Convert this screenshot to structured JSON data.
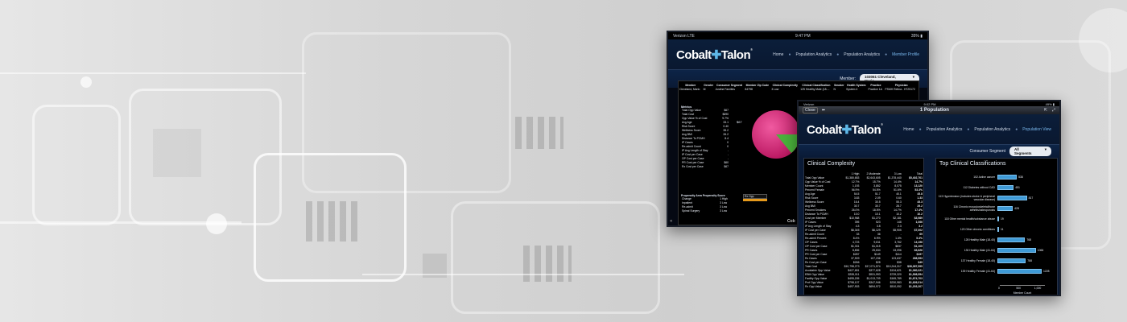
{
  "back_tablet": {
    "status": {
      "carrier": "Verizon  LTE",
      "time": "9:47 PM",
      "battery": "35% ▮"
    },
    "logo": {
      "text_a": "Cobalt",
      "text_b": "Talon",
      "mark": "®"
    },
    "breadcrumbs": [
      "Home",
      "Population Analytics",
      "Population Analytics",
      "Member Profile"
    ],
    "member_label": "Member:",
    "member_value": "103061 Cleveland, Mario",
    "columns": [
      "Member",
      "Gender",
      "Consumer Segment",
      "Member Zip Code",
      "Clinical Complexity",
      "Clinical Classification",
      "Smoker",
      "Health System",
      "Practice",
      "Physician"
    ],
    "row": [
      "Cleveland, Mario",
      "M",
      "Justine Families",
      "84798",
      "3 Low",
      "125 Healthy Male (18-...",
      "N",
      "System 4",
      "Practice 1A",
      "PSMH Retina - H725172"
    ],
    "metrics_title": "Metrics",
    "metrics": [
      [
        "Total Opp Value",
        "$67"
      ],
      [
        "Total Cost",
        "$690"
      ],
      [
        "Opp Value % of Cost",
        "9.7%"
      ],
      [
        "Avg Age",
        "33.1"
      ],
      [
        "Risk Score",
        "0.40"
      ],
      [
        "Wellness Score",
        "35.2"
      ],
      [
        "Avg BMI",
        "26.2"
      ],
      [
        "Distance To PCMH",
        "8.4"
      ],
      [
        "IP Cases",
        "0"
      ],
      [
        "Re-admit Count",
        "0"
      ],
      [
        "IP Avg Length of Stay",
        "-"
      ],
      [
        "IP Cost per Case",
        "-"
      ],
      [
        "OP Cost per Case",
        "-"
      ],
      [
        "PR Cost per Case",
        "$60"
      ],
      [
        "Rx Cost per Case",
        "$67"
      ]
    ],
    "pie_label": "$67",
    "pie_legend": "Rx Opp",
    "propensity_header": "Propensity Area  Propensity Score",
    "propensity": [
      [
        "Change",
        "1 High"
      ],
      [
        "Inpatient",
        "3 Low"
      ],
      [
        "Re-admit",
        "3 Low"
      ],
      [
        "Spinal Surgery",
        "3 Low"
      ]
    ],
    "footer_logo": "Cob"
  },
  "front_tablet": {
    "status": {
      "carrier": "Verizon",
      "time": "9:02 PM",
      "battery": "49% ▮"
    },
    "toolbar": {
      "close": "Close",
      "title": "1 Population"
    },
    "logo": {
      "text_a": "Cobalt",
      "text_b": "Talon",
      "mark": "®"
    },
    "breadcrumbs": [
      "Home",
      "Population Analytics",
      "Population Analytics",
      "Population View"
    ],
    "segment_label": "Consumer Segment",
    "segment_value": "All Segments",
    "complexity": {
      "title": "Clinical Complexity",
      "headers": [
        "",
        "1 High",
        "2 Moderate",
        "3 Low",
        "Total"
      ],
      "rows": [
        [
          "Total Opp Value",
          "$1,380,653",
          "$2,643,605",
          "$1,378,440",
          "$5,402,701"
        ],
        [
          "Opp Value % of Cost",
          "12.7%",
          "15.7%",
          "14.4%",
          "14.7%"
        ],
        [
          "Member Count",
          "1,193",
          "3,852",
          "8,075",
          "13,120"
        ],
        [
          "Percent Female",
          "56.9%",
          "54.5%",
          "51.6%",
          "53.3%"
        ],
        [
          "Avg Age",
          "54.5",
          "51.7",
          "40.1",
          "45.8"
        ],
        [
          "Risk Score",
          "3.83",
          "2.09",
          "0.60",
          "1.33"
        ],
        [
          "Wellness Score",
          "16.4",
          "30.5",
          "55.3",
          "45.3"
        ],
        [
          "Avg BMI",
          "30.7",
          "30.7",
          "28.7",
          "29.2"
        ],
        [
          "Percent Smokers",
          "26.0%",
          "18.5%",
          "14.7%",
          "17.4%"
        ],
        [
          "Distance To PCMH",
          "10.0",
          "10.1",
          "10.2",
          "10.2"
        ],
        [
          "Cost per Member",
          "$10,968",
          "$1,270",
          "$2,181",
          "$3,989"
        ],
        [
          "IP Cases",
          "395",
          "523",
          "148",
          "1,066"
        ],
        [
          "IP Avg Length of Stay",
          "4.3",
          "3.8",
          "2.3",
          "3.2"
        ],
        [
          "IP Cost per Case",
          "$6,345",
          "$6,129",
          "$5,905",
          "$7,002"
        ],
        [
          "Re-admit Count",
          "33",
          "36",
          "-",
          "69"
        ],
        [
          "Re-admit Percent",
          "8.4%",
          "6.9%",
          "1.4%",
          "5.3%"
        ],
        [
          "OP Cases",
          "4,723",
          "9,811",
          "3,762",
          "14,196"
        ],
        [
          "OP Cost per Case",
          "$1,331",
          "$1,015",
          "$837",
          "$1,105"
        ],
        [
          "PR Cases",
          "8,806",
          "25,634",
          "33,096",
          "83,826"
        ],
        [
          "PR Cost per Case",
          "$287",
          "$149",
          "$114",
          "$197"
        ],
        [
          "Rx Cases",
          "37,909",
          "107,236",
          "123,637",
          "268,593"
        ],
        [
          "Rx Cost per Case",
          "$266",
          "$28",
          "$38",
          "$49"
        ],
        [
          "Total Cost",
          "$10,798,273",
          "$17,071,574",
          "$10,244,317",
          "$38,087,595"
        ],
        [
          "Avoidable Opp Value",
          "$427,651",
          "$377,628",
          "$134,621",
          "$1,060,021"
        ],
        [
          "EBM Opp Value",
          "$335,011",
          "$931,993",
          "$739,320",
          "$1,508,554"
        ],
        [
          "Facility Opp Value",
          "$495,205",
          "$1,013,709",
          "$165,789",
          "$1,674,703"
        ],
        [
          "Prof Opp Value",
          "$798,107",
          "$347,946",
          "$230,983",
          "$1,626,014"
        ],
        [
          "Rx Opp Value",
          "$497,903",
          "$694,972",
          "$510,052",
          "$1,203,207"
        ]
      ]
    },
    "classifications": {
      "title": "Top Clinical Classifications",
      "xlabel": "Member Count",
      "ticks": [
        "0",
        "500",
        "1,000"
      ],
      "xmax": 1000
    }
  },
  "chart_data": {
    "type": "bar",
    "orientation": "horizontal",
    "title": "Top Clinical Classifications",
    "xlabel": "Member Count",
    "xlim": [
      0,
      1000
    ],
    "categories": [
      "102 Active cancer",
      "112 Diabetes without CAD",
      "113 Hypertension (includes stroke & peripheral vascular disease)",
      "116 Chronic musculoskeletal/bone arthritis/osteoporosis",
      "118 Other mental health/substance abuse",
      "120 Other chronic conditions",
      "128 Healthy Male (18-40)",
      "130 Healthy Male (41-64)",
      "137 Healthy Female (18-40)",
      "139 Healthy Female (41-64)"
    ],
    "values": [
      538,
      451,
      817,
      428,
      19,
      11,
      768,
      1066,
      788,
      1228
    ]
  }
}
